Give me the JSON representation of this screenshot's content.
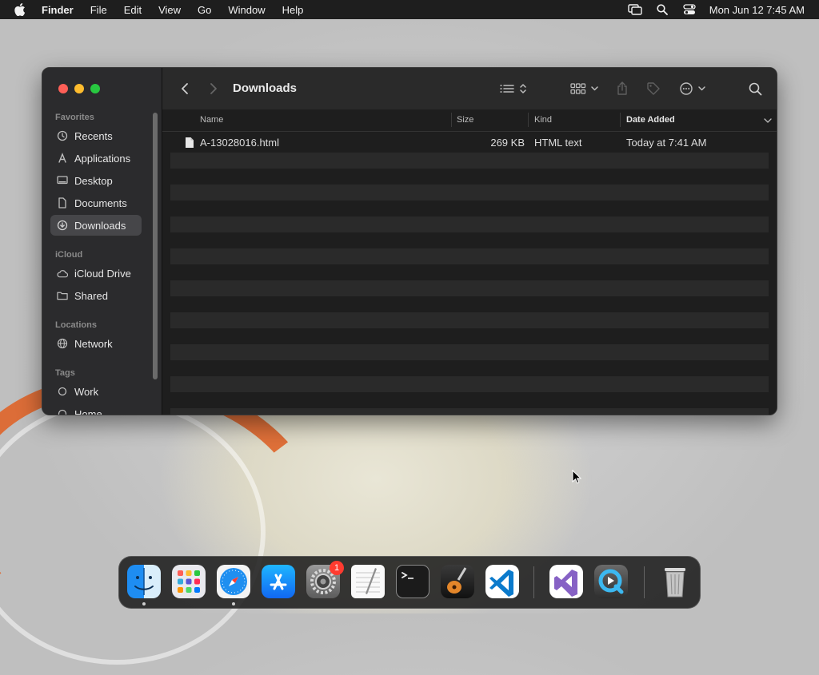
{
  "menubar": {
    "app": "Finder",
    "items": [
      "File",
      "Edit",
      "View",
      "Go",
      "Window",
      "Help"
    ],
    "clock": "Mon Jun 12  7:45 AM"
  },
  "window": {
    "title": "Downloads",
    "sidebar": {
      "favorites_label": "Favorites",
      "favorites": [
        "Recents",
        "Applications",
        "Desktop",
        "Documents",
        "Downloads"
      ],
      "icloud_label": "iCloud",
      "icloud": [
        "iCloud Drive",
        "Shared"
      ],
      "locations_label": "Locations",
      "locations": [
        "Network"
      ],
      "tags_label": "Tags",
      "tags": [
        "Work",
        "Home"
      ]
    },
    "columns": {
      "name": "Name",
      "size": "Size",
      "kind": "Kind",
      "date": "Date Added"
    },
    "files": [
      {
        "name": "A-13028016.html",
        "size": "269 KB",
        "kind": "HTML text",
        "date": "Today at 7:41 AM"
      }
    ]
  },
  "dock": {
    "badge_settings": "1",
    "apps": [
      "finder",
      "launchpad",
      "safari",
      "app-store",
      "system-settings",
      "textedit",
      "terminal",
      "garageband",
      "vscode",
      "visual-studio",
      "quicktime",
      "trash"
    ]
  },
  "colors": {
    "accent_red": "#fe5f57",
    "accent_yellow": "#febc2e",
    "accent_green": "#28c840",
    "badge": "#ff3b30"
  }
}
